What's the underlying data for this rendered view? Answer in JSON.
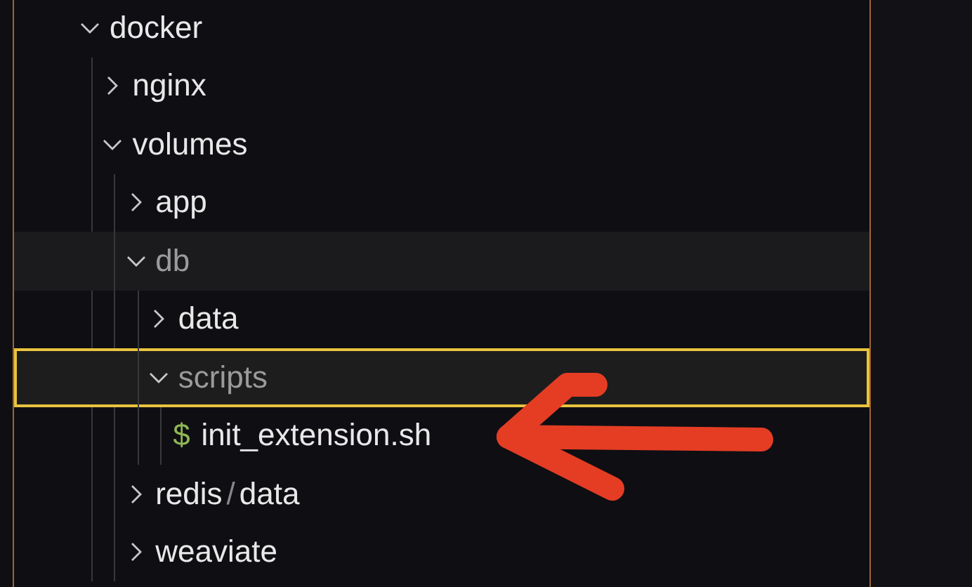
{
  "tree": [
    {
      "kind": "folder",
      "name": "docker",
      "expanded": true,
      "dimmed": false,
      "highlighted": false,
      "selected": false,
      "children": [
        {
          "kind": "folder",
          "name": "nginx",
          "expanded": false,
          "dimmed": false,
          "highlighted": false,
          "selected": false
        },
        {
          "kind": "folder",
          "name": "volumes",
          "expanded": true,
          "dimmed": false,
          "highlighted": false,
          "selected": false,
          "children": [
            {
              "kind": "folder",
              "name": "app",
              "expanded": false,
              "dimmed": false,
              "highlighted": false,
              "selected": false
            },
            {
              "kind": "folder",
              "name": "db",
              "expanded": true,
              "dimmed": true,
              "highlighted": true,
              "selected": false,
              "children": [
                {
                  "kind": "folder",
                  "name": "data",
                  "expanded": false,
                  "dimmed": false,
                  "highlighted": false,
                  "selected": false
                },
                {
                  "kind": "folder",
                  "name": "scripts",
                  "expanded": true,
                  "dimmed": true,
                  "highlighted": false,
                  "selected": true,
                  "children": [
                    {
                      "kind": "shell-file",
                      "name": "init_extension.sh",
                      "icon_text": "$",
                      "dimmed": false,
                      "highlighted": false,
                      "selected": false
                    }
                  ]
                }
              ]
            },
            {
              "kind": "folder",
              "name_parts": [
                "redis",
                "/",
                "data"
              ],
              "expanded": false,
              "dimmed": false,
              "highlighted": false,
              "selected": false
            },
            {
              "kind": "folder",
              "name": "weaviate",
              "expanded": false,
              "dimmed": false,
              "highlighted": false,
              "selected": false
            }
          ]
        }
      ]
    }
  ]
}
